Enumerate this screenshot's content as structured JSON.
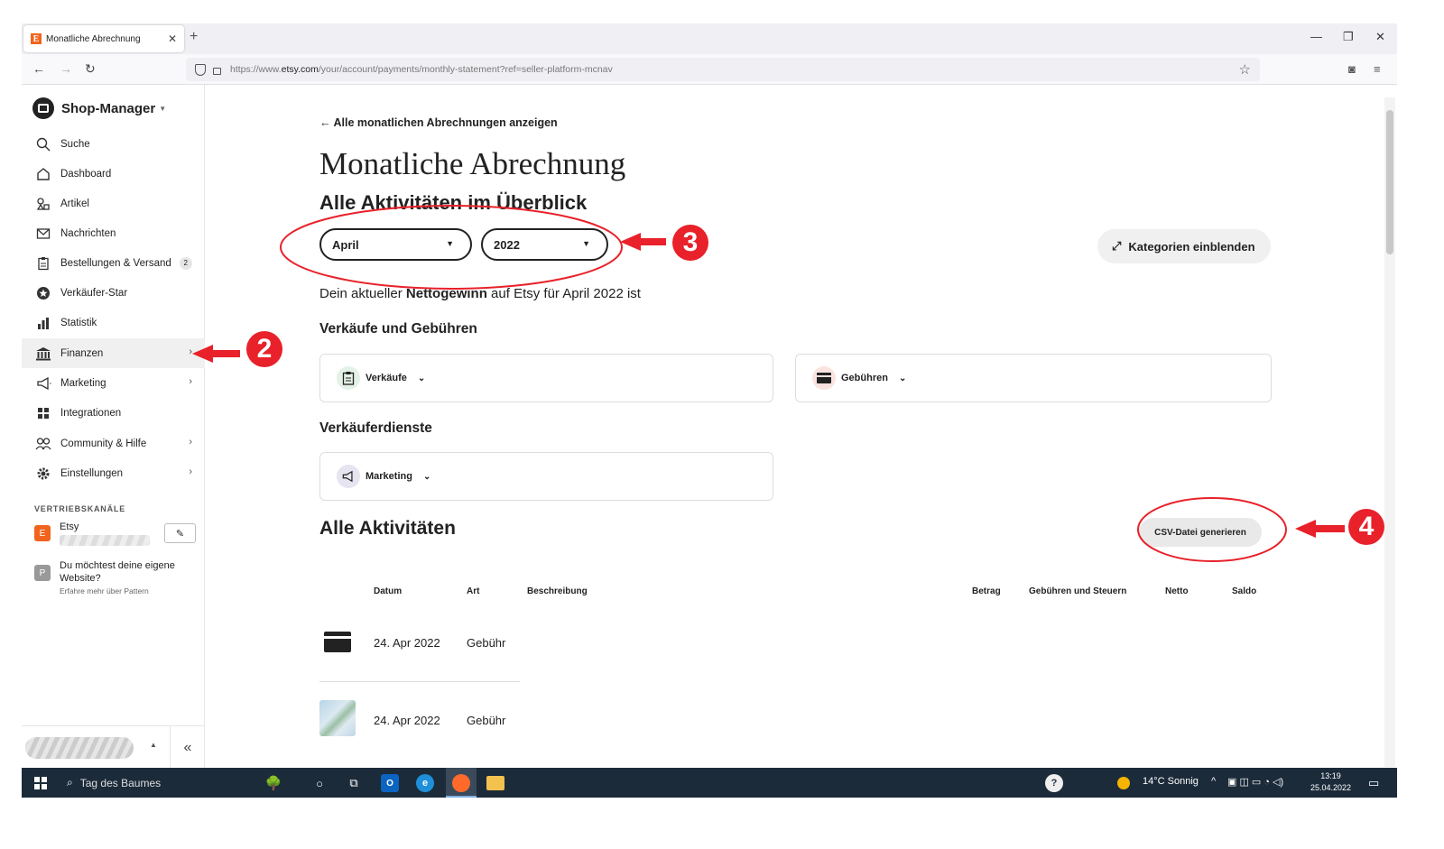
{
  "browser": {
    "tab_title": "Monatliche Abrechnung",
    "tab_favicon": "E",
    "url_prefix": "https://www.",
    "url_domain": "etsy.com",
    "url_path": "/your/account/payments/monthly-statement?ref=seller-platform-mcnav"
  },
  "sidebar": {
    "title": "Shop-Manager",
    "items": [
      {
        "label": "Suche"
      },
      {
        "label": "Dashboard"
      },
      {
        "label": "Artikel"
      },
      {
        "label": "Nachrichten"
      },
      {
        "label": "Bestellungen & Versand",
        "badge": "2"
      },
      {
        "label": "Verkäufer-Star"
      },
      {
        "label": "Statistik"
      },
      {
        "label": "Finanzen"
      },
      {
        "label": "Marketing"
      },
      {
        "label": "Integrationen"
      },
      {
        "label": "Community & Hilfe"
      },
      {
        "label": "Einstellungen"
      }
    ],
    "channels_heading": "VERTRIEBSKANÄLE",
    "channel_name": "Etsy",
    "channel_icon": "E",
    "website_title": "Du möchtest deine eigene Website?",
    "website_icon": "P",
    "website_sub": "Erfahre mehr über Pattern"
  },
  "main": {
    "back_link": "← Alle monatlichen Abrechnungen anzeigen",
    "title": "Monatliche Abrechnung",
    "subtitle": "Alle Aktivitäten im Überblick",
    "month": "April",
    "year": "2022",
    "categories_button": "Kategorien einblenden",
    "net_prefix": "Dein aktueller ",
    "net_bold": "Nettogewinn",
    "net_suffix": " auf Etsy für April 2022 ist",
    "sales_fees_heading": "Verkäufe und Gebühren",
    "card_sales": "Verkäufe",
    "card_fees": "Gebühren",
    "services_heading": "Verkäuferdienste",
    "card_marketing": "Marketing",
    "all_activities": "Alle Aktivitäten",
    "csv_button": "CSV-Datei generieren",
    "columns": [
      "Datum",
      "Art",
      "Beschreibung",
      "Betrag",
      "Gebühren und Steuern",
      "Netto",
      "Saldo"
    ],
    "rows": [
      {
        "date": "24. Apr 2022",
        "type": "Gebühr"
      },
      {
        "date": "24. Apr 2022",
        "type": "Gebühr"
      }
    ]
  },
  "annotations": [
    "2",
    "3",
    "4"
  ],
  "taskbar": {
    "search": "Tag des Baumes",
    "weather": "14°C  Sonnig",
    "time": "13:19",
    "date": "25.04.2022"
  },
  "colors": {
    "accent_orange": "#f1641e",
    "annotation_red": "#e8212a"
  }
}
